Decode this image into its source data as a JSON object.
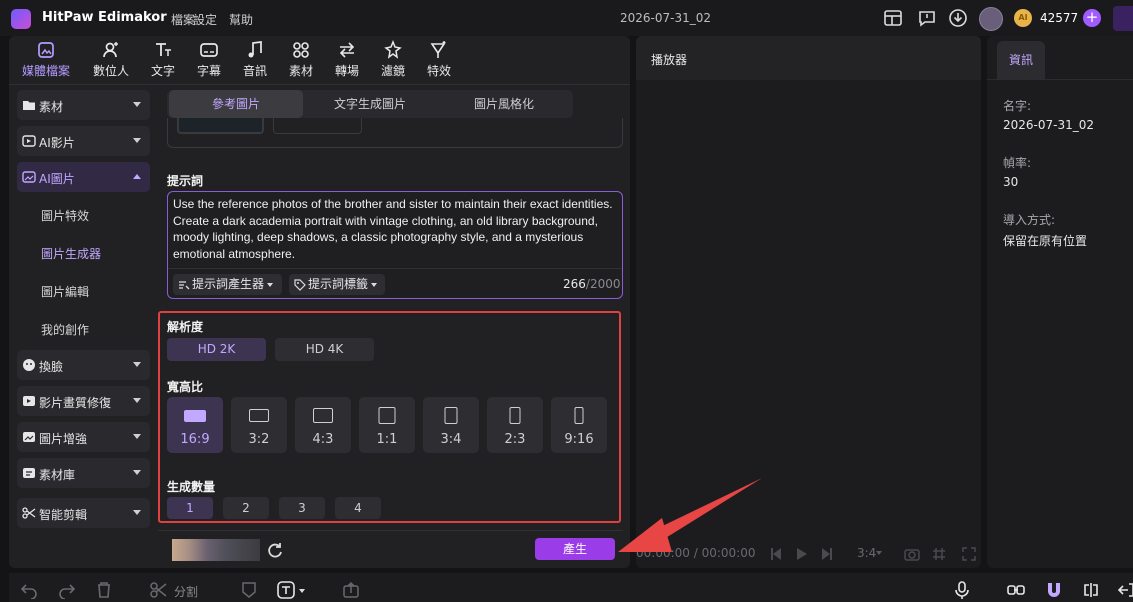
{
  "app": {
    "name": "HitPaw Edimakor",
    "menus": [
      "檔案",
      "設定",
      "幫助"
    ],
    "doc_title": "2026-07-31_02",
    "coins": "42577",
    "coin_label": "AI"
  },
  "toolbar": [
    {
      "label": "媒體檔案",
      "icon": "media-icon",
      "active": true
    },
    {
      "label": "數位人",
      "icon": "avatar-icon"
    },
    {
      "label": "文字",
      "icon": "text-icon"
    },
    {
      "label": "字幕",
      "icon": "subtitle-icon"
    },
    {
      "label": "音訊",
      "icon": "music-icon"
    },
    {
      "label": "素材",
      "icon": "assets-icon"
    },
    {
      "label": "轉場",
      "icon": "transition-icon"
    },
    {
      "label": "濾鏡",
      "icon": "filter-icon"
    },
    {
      "label": "特效",
      "icon": "effects-icon"
    }
  ],
  "sidebar": {
    "items": [
      {
        "label": "素材",
        "icon": "folder-icon"
      },
      {
        "label": "AI影片",
        "icon": "ai-video-icon"
      },
      {
        "label": "AI圖片",
        "icon": "ai-image-icon",
        "active": true
      },
      {
        "label": "換臉",
        "icon": "face-swap-icon"
      },
      {
        "label": "影片畫質修復",
        "icon": "video-repair-icon"
      },
      {
        "label": "圖片增強",
        "icon": "image-enhance-icon"
      },
      {
        "label": "素材庫",
        "icon": "library-icon"
      },
      {
        "label": "智能剪輯",
        "icon": "smart-cut-icon"
      }
    ],
    "sub_items": [
      "圖片特效",
      "圖片生成器",
      "圖片編輯",
      "我的創作"
    ]
  },
  "tabs": [
    {
      "label": "參考圖片",
      "active": true
    },
    {
      "label": "文字生成圖片"
    },
    {
      "label": "圖片風格化"
    }
  ],
  "prompt": {
    "label": "提示詞",
    "text": "Use the reference photos of the brother and sister to maintain their exact identities. Create a dark academia portrait with vintage clothing, an old library background, moody lighting, deep shadows, a classic photography style, and a mysterious emotional atmosphere.",
    "generator": "提示詞產生器",
    "tags": "提示詞標籤",
    "count": "266",
    "max": "/2000"
  },
  "resolution": {
    "label": "解析度",
    "options": [
      {
        "label": "HD 2K",
        "active": true
      },
      {
        "label": "HD 4K"
      }
    ]
  },
  "aspect": {
    "label": "寬高比",
    "options": [
      {
        "label": "16:9",
        "active": true
      },
      {
        "label": "3:2"
      },
      {
        "label": "4:3"
      },
      {
        "label": "1:1"
      },
      {
        "label": "3:4"
      },
      {
        "label": "2:3"
      },
      {
        "label": "9:16"
      }
    ]
  },
  "quantity": {
    "label": "生成數量",
    "options": [
      {
        "label": "1",
        "active": true
      },
      {
        "label": "2"
      },
      {
        "label": "3"
      },
      {
        "label": "4"
      }
    ]
  },
  "generate_label": "產生",
  "player": {
    "title": "播放器",
    "time": "00:00:00 / 00:00:00",
    "ratio": "3:4"
  },
  "info": {
    "tab": "資訊",
    "fields": [
      {
        "key": "名字:",
        "value": "2026-07-31_02"
      },
      {
        "key": "幀率:",
        "value": "30"
      },
      {
        "key": "導入方式:",
        "value": "保留在原有位置"
      }
    ]
  },
  "bottom": {
    "split_label": "分割"
  },
  "colors": {
    "accent": "#9a3de8",
    "highlight": "#e04040",
    "active_text": "#c2a8ff"
  }
}
